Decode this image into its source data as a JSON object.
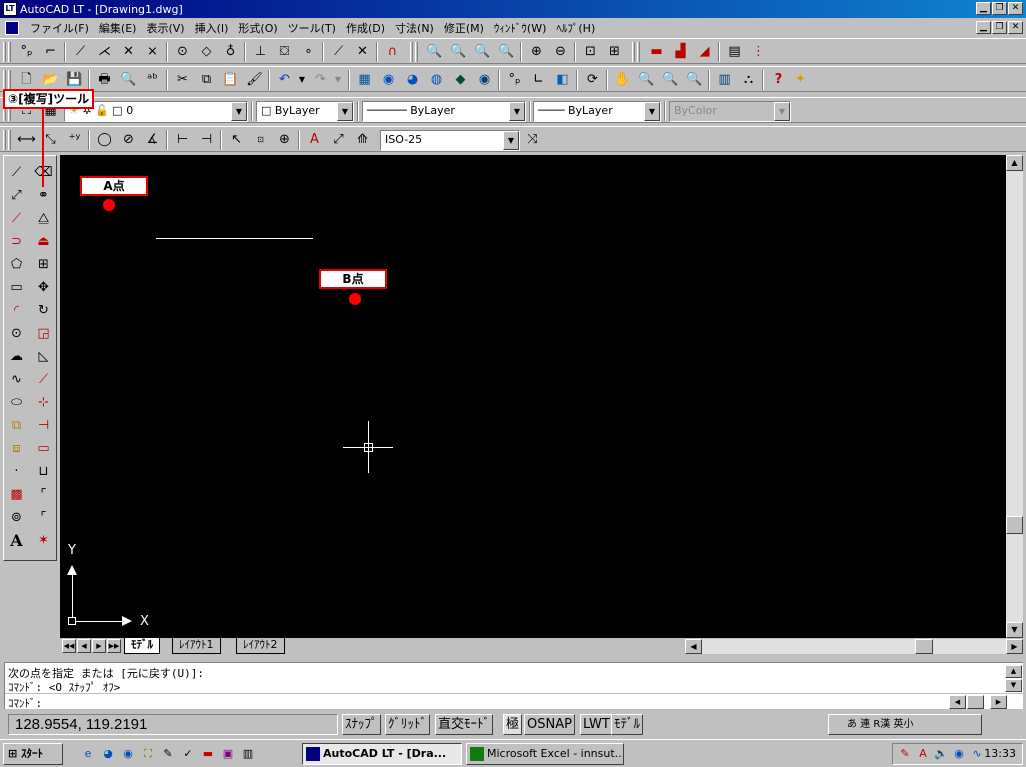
{
  "window": {
    "title": "AutoCAD LT - [Drawing1.dwg]",
    "app_icon_text": "LT"
  },
  "menu": {
    "items": [
      "ファイル(F)",
      "編集(E)",
      "表示(V)",
      "挿入(I)",
      "形式(O)",
      "ツール(T)",
      "作成(D)",
      "寸法(N)",
      "修正(M)",
      "ｳｨﾝﾄﾞｳ(W)",
      "ﾍﾙﾌﾟ(H)"
    ]
  },
  "callout": {
    "label": "③[複写]ツール",
    "color": "#e60000"
  },
  "properties": {
    "layer_value": "0",
    "color_value": "ByLayer",
    "linetype_value": "ByLayer",
    "lineweight_value": "ByLayer",
    "plotstyle_value": "ByColor"
  },
  "dimstyle": {
    "value": "ISO-25"
  },
  "drawing": {
    "point_a_label": "A点",
    "point_b_label": "B点",
    "dot_color": "#ff0000",
    "line_color": "#ffffff",
    "background": "#000000",
    "ucs_y": "Y",
    "ucs_x": "X"
  },
  "layout_tabs": [
    "ﾓﾃﾞﾙ",
    "ﾚｲｱｳﾄ1",
    "ﾚｲｱｳﾄ2"
  ],
  "command": {
    "line1": "次の点を指定 または [元に戻す(U)]:",
    "line2": "ｺﾏﾝﾄﾞ:  <O ｽﾅｯﾌﾟ ｵﾌ>",
    "line3": "ｺﾏﾝﾄﾞ:"
  },
  "status": {
    "coords": "128.9554, 119.2191",
    "toggles": [
      "ｽﾅｯﾌﾟ",
      "ｸﾞﾘｯﾄﾞ",
      "直交ﾓｰﾄﾞ",
      "極",
      "OSNAP",
      "LWT",
      "ﾓﾃﾞﾙ"
    ],
    "ime": "あ 連 R漢 英小"
  },
  "taskbar": {
    "start_label": "ｽﾀｰﾄ",
    "tasks": [
      "AutoCAD LT - [Dra...",
      "Microsoft Excel - innsut..."
    ],
    "clock": "13:33"
  }
}
